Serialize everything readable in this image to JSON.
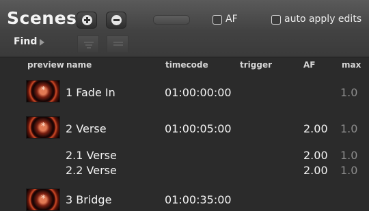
{
  "panel": {
    "title": "Scenes",
    "af_checkbox_label": "AF",
    "auto_apply_label": "auto apply edits",
    "find_label": "Find"
  },
  "columns": {
    "preview": "preview",
    "name": "name",
    "timecode": "timecode",
    "trigger": "trigger",
    "af": "AF",
    "max": "max"
  },
  "rows": [
    {
      "name": "1 Fade In",
      "timecode": "01:00:00:00",
      "af": "",
      "max": "1.0",
      "has_preview": true
    },
    {
      "name": "2 Verse",
      "timecode": "01:00:05:00",
      "af": "2.00",
      "max": "1.0",
      "has_preview": true
    },
    {
      "name": "2.1 Verse",
      "timecode": "",
      "af": "2.00",
      "max": "1.0",
      "has_preview": false
    },
    {
      "name": "2.2 Verse",
      "timecode": "",
      "af": "2.00",
      "max": "1.0",
      "has_preview": false
    },
    {
      "name": "3 Bridge",
      "timecode": "01:00:35:00",
      "af": "",
      "max": "",
      "has_preview": true
    }
  ],
  "icons": {
    "add": "plus-circle-icon",
    "remove": "minus-circle-icon",
    "find_arrow": "triangle-right-icon",
    "filter": "filter-lines-icon"
  },
  "colors": {
    "background": "#2b2b2b",
    "toolbar": "#484848",
    "text": "#f4f4f4",
    "dim_text": "#8e8e8e"
  }
}
